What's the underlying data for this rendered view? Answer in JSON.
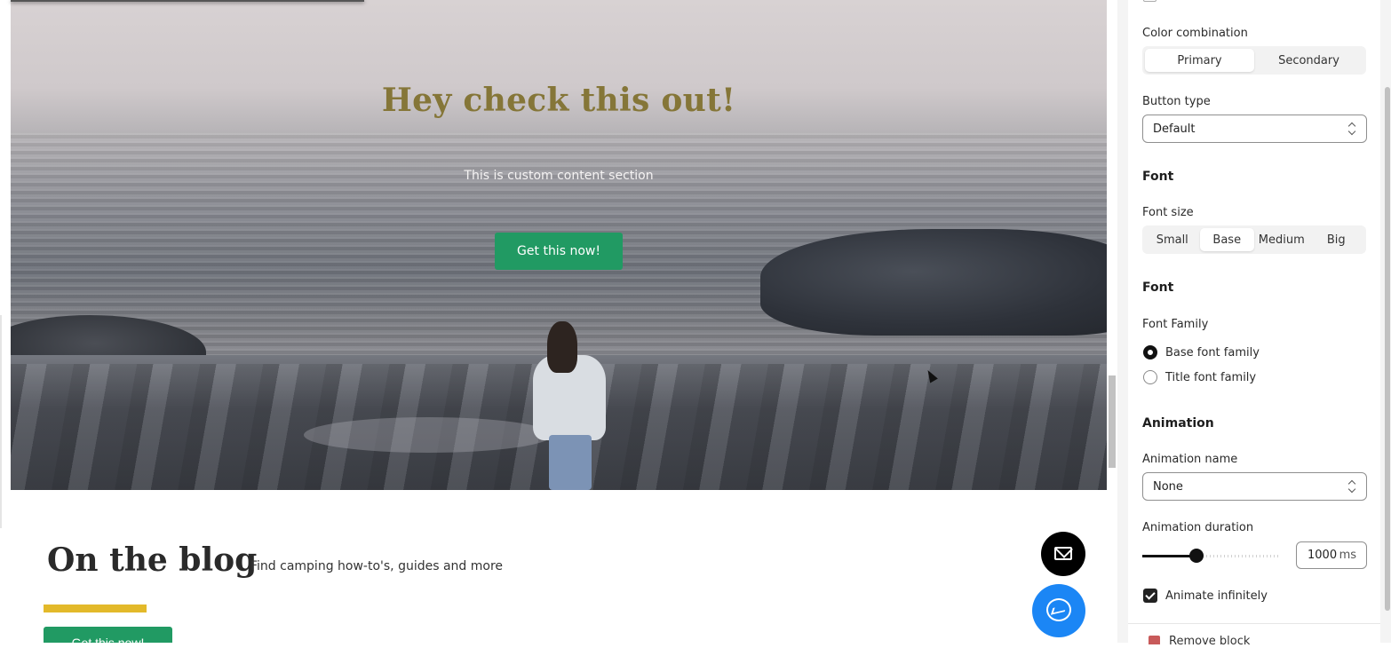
{
  "hero": {
    "title": "Hey check this out!",
    "subtitle": "This is custom content section",
    "button_label": "Get this now!"
  },
  "blog": {
    "title": "On the blog",
    "subtitle": "Find camping how-to's, guides and more",
    "button_label": "Get this now!"
  },
  "panel": {
    "color_combination": {
      "label": "Color combination",
      "options": [
        "Primary",
        "Secondary"
      ],
      "selected": "Primary"
    },
    "button_type": {
      "label": "Button type",
      "value": "Default"
    },
    "font_section_1": "Font",
    "font_size": {
      "label": "Font size",
      "options": [
        "Small",
        "Base",
        "Medium",
        "Big"
      ],
      "selected": "Base"
    },
    "font_section_2": "Font",
    "font_family": {
      "label": "Font Family",
      "options": [
        "Base font family",
        "Title font family"
      ],
      "selected": "Base font family"
    },
    "animation": {
      "section": "Animation",
      "name_label": "Animation name",
      "name_value": "None",
      "duration_label": "Animation duration",
      "duration_value": "1000",
      "duration_unit": "ms",
      "duration_slider_fraction": 0.39,
      "infinite_label": "Animate infinitely",
      "infinite_checked": true
    },
    "footer_text": "Remove block"
  },
  "colors": {
    "accent_green": "#219a63",
    "title_olive": "#857638",
    "blog_bar_yellow": "#e3b92a",
    "messenger_blue": "#1b86f5"
  },
  "icons": [
    "mail-icon",
    "messenger-icon",
    "chevron-updown-icon",
    "check-icon",
    "mouse-cursor-icon",
    "remove-block-icon"
  ]
}
